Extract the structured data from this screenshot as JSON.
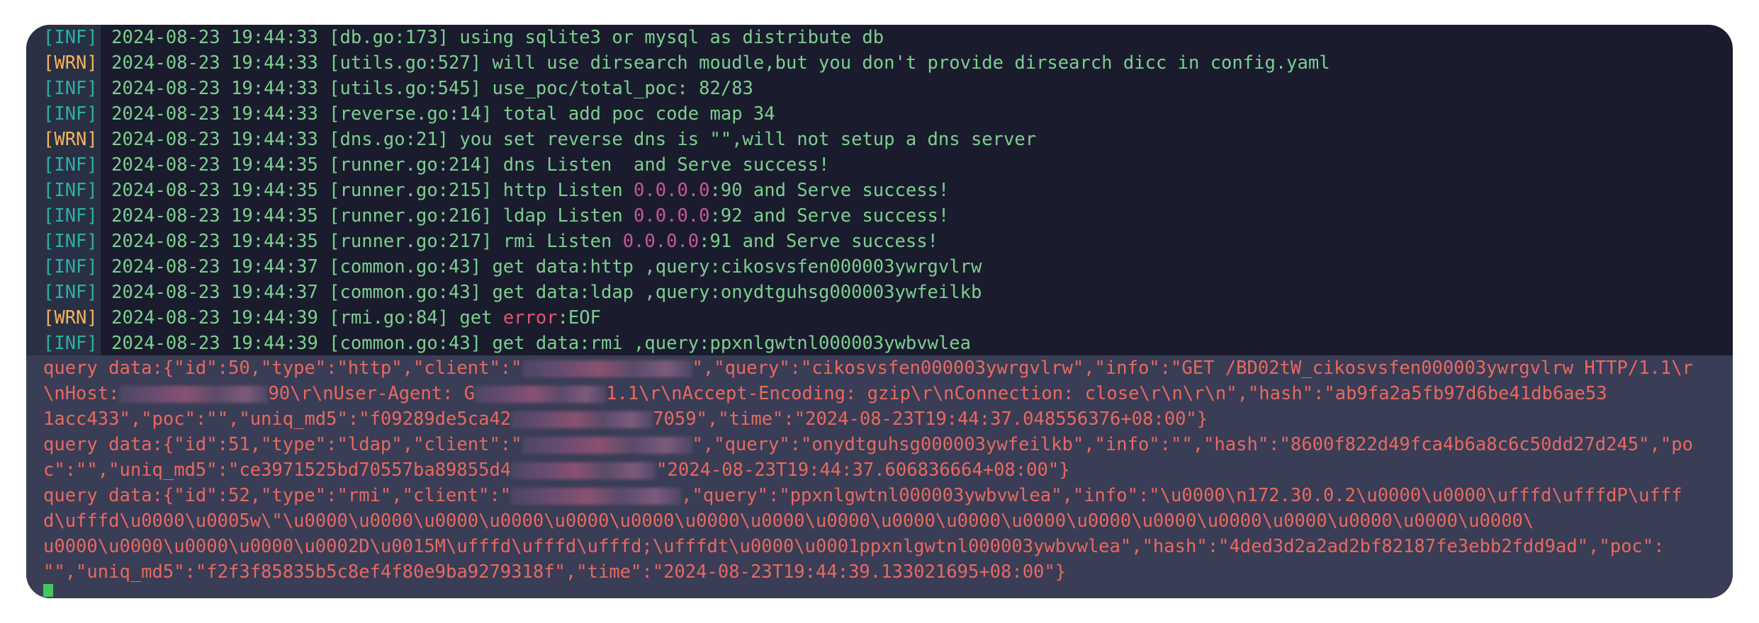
{
  "log_lines": [
    {
      "level": "[INF]",
      "text": " 2024-08-23 19:44:33 [db.go:173] using sqlite3 or mysql as distribute db"
    },
    {
      "level": "[WRN]",
      "text": " 2024-08-23 19:44:33 [utils.go:527] will use dirsearch moudle,but you don't provide dirsearch dicc in config.yaml"
    },
    {
      "level": "[INF]",
      "text": " 2024-08-23 19:44:33 [utils.go:545] use_poc/total_poc: 82/83"
    },
    {
      "level": "[INF]",
      "text": " 2024-08-23 19:44:33 [reverse.go:14] total add poc code map 34"
    },
    {
      "level": "[WRN]",
      "text": " 2024-08-23 19:44:33 [dns.go:21] you set reverse dns is \"\",will not setup a dns server"
    },
    {
      "level": "[INF]",
      "text": " 2024-08-23 19:44:35 [runner.go:214] dns Listen  and Serve success!"
    },
    {
      "level": "[INF]",
      "pre": " 2024-08-23 19:44:35 [runner.go:215] http Listen ",
      "ip": "0.0.0.0",
      "post": ":90 and Serve success!"
    },
    {
      "level": "[INF]",
      "pre": " 2024-08-23 19:44:35 [runner.go:216] ldap Listen ",
      "ip": "0.0.0.0",
      "post": ":92 and Serve success!"
    },
    {
      "level": "[INF]",
      "pre": " 2024-08-23 19:44:35 [runner.go:217] rmi Listen ",
      "ip": "0.0.0.0",
      "post": ":91 and Serve success!"
    },
    {
      "level": "[INF]",
      "text": " 2024-08-23 19:44:37 [common.go:43] get data:http ,query:cikosvsfen000003ywrgvlrw"
    },
    {
      "level": "[INF]",
      "text": " 2024-08-23 19:44:37 [common.go:43] get data:ldap ,query:onydtguhsg000003ywfeilkb"
    },
    {
      "level": "[WRN]",
      "pre": " 2024-08-23 19:44:39 [rmi.go:84] get ",
      "err": "error",
      "post": ":EOF"
    },
    {
      "level": "[INF]",
      "text": " 2024-08-23 19:44:39 [common.go:43] get data:rmi ,query:ppxnlgwtnl000003ywbvwlea"
    }
  ],
  "query_lines": [
    {
      "a": "query data:{\"id\":50,\"type\":\"http\",\"client\":\"",
      "blur_w": 240,
      "b": "\",\"query\":\"cikosvsfen000003ywrgvlrw\",\"info\":\"GET /BD02tW_cikosvsfen000003ywrgvlrw HTTP/1.1\\r"
    },
    {
      "a": "\\nHost:",
      "blur_w": 210,
      "b": "90\\r\\nUser-Agent: G",
      "blur2_w": 185,
      "c": "1.1\\r\\nAccept-Encoding: gzip\\r\\nConnection: close\\r\\n\\r\\n\",\"hash\":\"ab9fa2a5fb97d6be41db6ae53"
    },
    {
      "a": "1acc433\",\"poc\":\"\",\"uniq_md5\":\"f09289de5ca42",
      "blur_w": 200,
      "b": "7059\",\"time\":\"2024-08-23T19:44:37.048556376+08:00\"}"
    },
    {
      "a": "query data:{\"id\":51,\"type\":\"ldap\",\"client\":\"",
      "blur_w": 240,
      "b": "\",\"query\":\"onydtguhsg000003ywfeilkb\",\"info\":\"\",\"hash\":\"8600f822d49fca4b6a8c6c50dd27d245\",\"po"
    },
    {
      "a": "c\":\"\",\"uniq_md5\":\"ce3971525bd70557ba89855d4",
      "blur_w": 205,
      "b": "\"2024-08-23T19:44:37.606836664+08:00\"}"
    },
    {
      "a": "query data:{\"id\":52,\"type\":\"rmi\",\"client\":\"",
      "blur_w": 240,
      "b": ",\"query\":\"ppxnlgwtnl000003ywbvwlea\",\"info\":\"\\u0000\\n172.30.0.2\\u0000\\u0000\\ufffd\\ufffdP\\ufff"
    },
    {
      "a": "d\\ufffd\\u0000\\u0005w\\\"\\u0000\\u0000\\u0000\\u0000\\u0000\\u0000\\u0000\\u0000\\u0000\\u0000\\u0000\\u0000\\u0000\\u0000\\u0000\\u0000\\u0000\\u0000\\u0000\\"
    },
    {
      "a": "u0000\\u0000\\u0000\\u0000\\u0002D\\u0015M\\ufffd\\ufffd\\ufffd;\\ufffdt\\u0000\\u0001ppxnlgwtnl000003ywbvwlea\",\"hash\":\"4ded3d2a2ad2bf82187fe3ebb2fdd9ad\",\"poc\":"
    },
    {
      "a": "\"\",\"uniq_md5\":\"f2f3f85835b5c8ef4f80e9ba9279318f\",\"time\":\"2024-08-23T19:44:39.133021695+08:00\"}"
    }
  ]
}
